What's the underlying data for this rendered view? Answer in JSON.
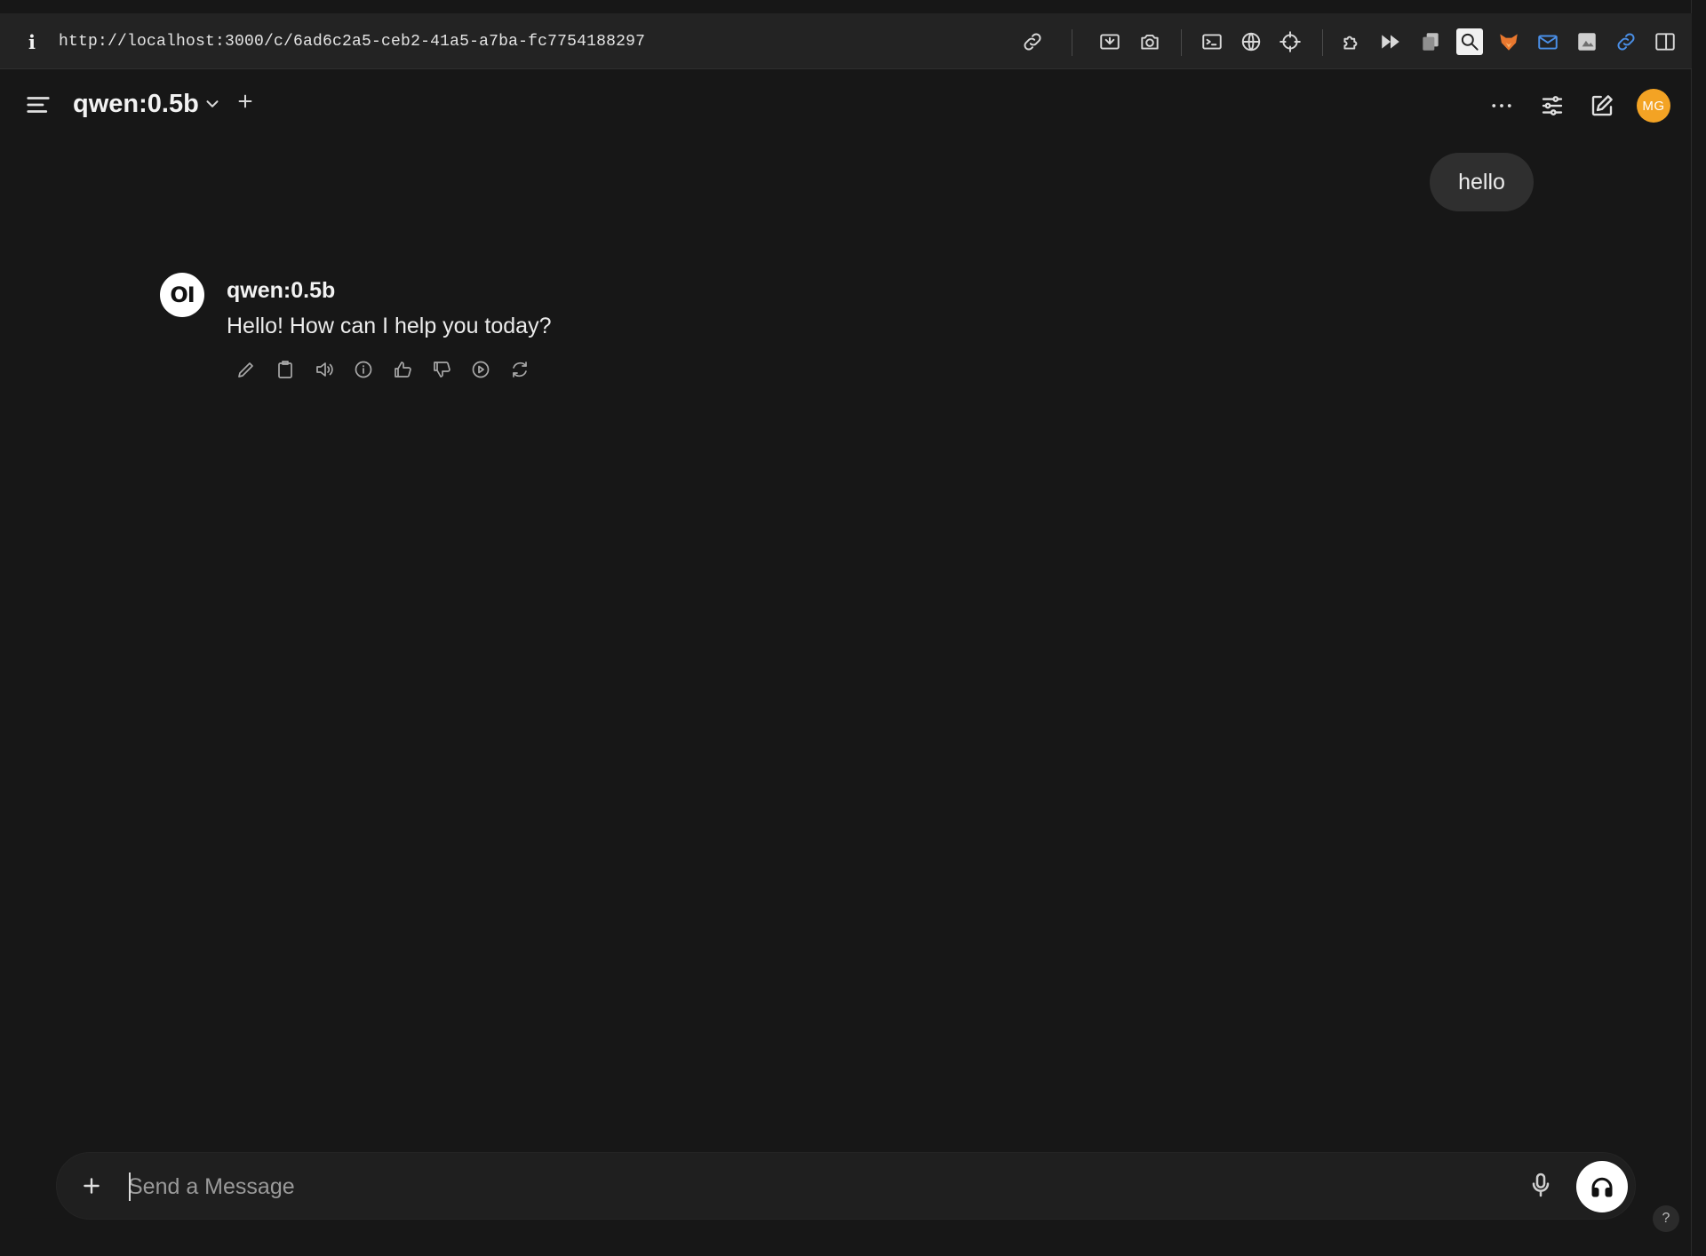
{
  "browser": {
    "url": "http://localhost:3000/c/6ad6c2a5-ceb2-41a5-a7ba-fc7754188297",
    "info_glyph": "i",
    "toolbar_icons": [
      "link-icon",
      "screenshot-icon",
      "camera-icon",
      "terminal-icon",
      "globe-icon",
      "crosshair-icon",
      "extension-icon",
      "forward-icon",
      "copy-icon",
      "search-icon",
      "fox-icon",
      "mail-icon",
      "image-icon",
      "link-icon",
      "sidebar-toggle-icon"
    ]
  },
  "header": {
    "model_name": "qwen:0.5b",
    "avatar_initials": "MG",
    "avatar_color": "#f3a324"
  },
  "chat": {
    "user_message": "hello",
    "assistant": {
      "logo_text": "OI",
      "name": "qwen:0.5b",
      "text": "Hello! How can I help you today?"
    },
    "actions": [
      "edit-icon",
      "copy-icon",
      "speaker-icon",
      "info-icon",
      "thumbs-up-icon",
      "thumbs-down-icon",
      "play-icon",
      "regenerate-icon"
    ]
  },
  "input": {
    "placeholder": "Send a Message",
    "value": ""
  },
  "help": {
    "label": "?"
  },
  "colors": {
    "background": "#171717",
    "bubble": "#2f2f2f",
    "input": "#1f1f1f"
  }
}
